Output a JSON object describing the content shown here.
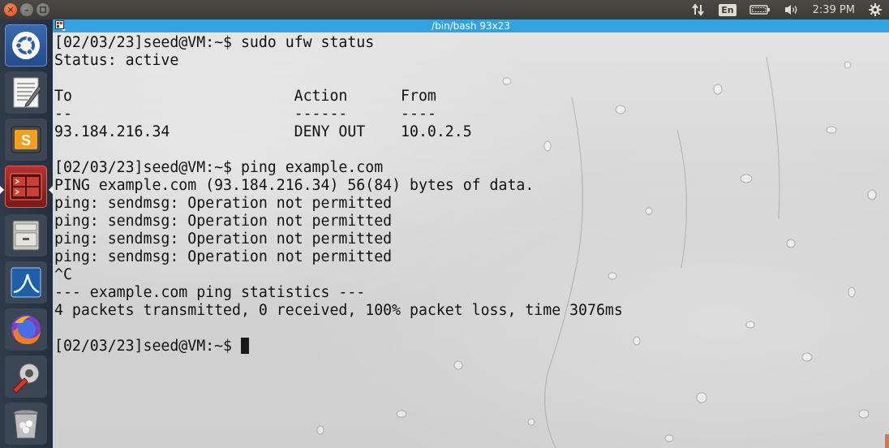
{
  "top_panel": {
    "clock": "2:39 PM",
    "keyboard_layout": "En"
  },
  "terminal": {
    "title": "/bin/bash 93x23",
    "lines": [
      "[02/03/23]seed@VM:~$ sudo ufw status",
      "Status: active",
      "",
      "To                         Action      From",
      "--                         ------      ----",
      "93.184.216.34              DENY OUT    10.0.2.5",
      "",
      "[02/03/23]seed@VM:~$ ping example.com",
      "PING example.com (93.184.216.34) 56(84) bytes of data.",
      "ping: sendmsg: Operation not permitted",
      "ping: sendmsg: Operation not permitted",
      "ping: sendmsg: Operation not permitted",
      "ping: sendmsg: Operation not permitted",
      "^C",
      "--- example.com ping statistics ---",
      "4 packets transmitted, 0 received, 100% packet loss, time 3076ms",
      ""
    ],
    "prompt": "[02/03/23]seed@VM:~$ "
  },
  "launcher": {
    "items": [
      {
        "name": "ubuntu-dash",
        "icon": "ubuntu-logo-icon"
      },
      {
        "name": "text-editor",
        "icon": "text-editor-icon"
      },
      {
        "name": "sublime-text",
        "icon": "sublime-text-icon"
      },
      {
        "name": "terminal",
        "icon": "terminal-icon"
      },
      {
        "name": "files",
        "icon": "file-cabinet-icon"
      },
      {
        "name": "wireshark",
        "icon": "wireshark-fin-icon"
      },
      {
        "name": "firefox",
        "icon": "firefox-icon"
      },
      {
        "name": "system-settings",
        "icon": "settings-wrench-icon"
      },
      {
        "name": "trash",
        "icon": "trash-icon"
      }
    ]
  },
  "colors": {
    "title_bar": "#33a2e0",
    "terminal_text": "#111111",
    "panel_bg": "#3c3b37"
  }
}
